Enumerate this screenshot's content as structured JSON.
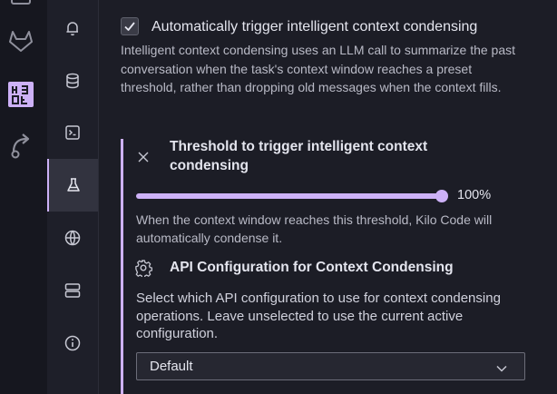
{
  "activity_bar": {
    "icons": [
      "extension-icon",
      "gitlab-icon",
      "kilo-code-icon",
      "remote-share-icon"
    ]
  },
  "settings_nav": {
    "items": [
      {
        "icon": "bell-icon",
        "label": "Notifications"
      },
      {
        "icon": "database-icon",
        "label": "Context"
      },
      {
        "icon": "terminal-icon",
        "label": "Terminal"
      },
      {
        "icon": "flask-icon",
        "label": "Experimental",
        "active": true
      },
      {
        "icon": "globe-icon",
        "label": "Language"
      },
      {
        "icon": "server-icon",
        "label": "MCP servers"
      },
      {
        "icon": "info-icon",
        "label": "About"
      }
    ]
  },
  "condensing": {
    "checkbox_checked": true,
    "checkbox_label": "Automatically trigger intelligent context condensing",
    "description": "Intelligent context condensing uses an LLM call to summarize the past conversation when the task's context window reaches a preset threshold, rather than dropping old messages when the context fills."
  },
  "threshold": {
    "title": "Threshold to trigger intelligent context condensing",
    "value_percent": 100,
    "value_label": "100%",
    "description": "When the context window reaches this threshold, Kilo Code will automatically condense it."
  },
  "api_config": {
    "title": "API Configuration for Context Condensing",
    "description": "Select which API configuration to use for context condensing operations. Leave unselected to use the current active configuration.",
    "selected": "Default"
  },
  "colors": {
    "accent": "#cdb1f7",
    "background": "#1c1d26"
  }
}
